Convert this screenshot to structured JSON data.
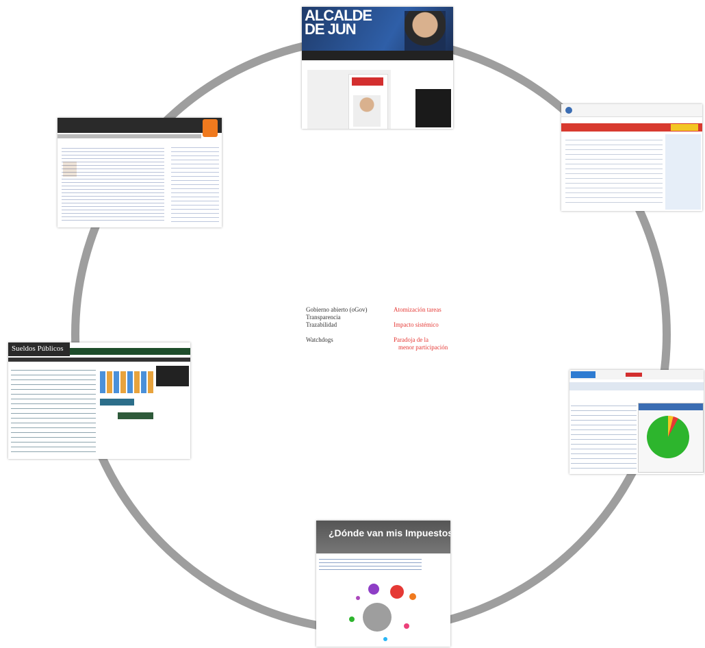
{
  "center": {
    "left_items": [
      "Gobierno abierto (oGov)",
      "Transparencia",
      "Trazabilidad",
      "Watchdogs"
    ],
    "right_items": [
      "Atomización tareas",
      "Impacto sistémico",
      "Paradoja de la",
      "menor participación"
    ]
  },
  "thumbnails": {
    "alcalde": {
      "title_line1": "ALCALDE",
      "title_line2": "DE JUN"
    },
    "impuestos": {
      "title": "¿Dónde van mis Impuestos?"
    },
    "sueldos": {
      "title": "Sueldos Públicos"
    }
  },
  "colors": {
    "ring": "#9e9e9e",
    "accent_red": "#e53935",
    "accent_orange": "#f07a1e",
    "pie_green": "#2db52d"
  }
}
